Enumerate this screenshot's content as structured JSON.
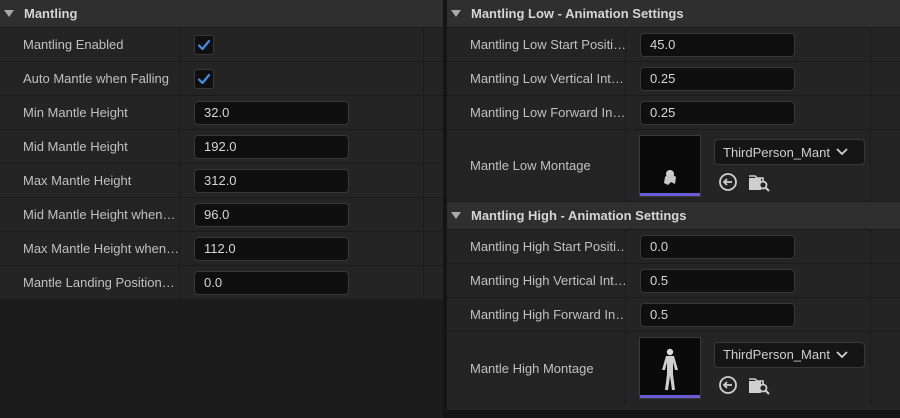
{
  "left": {
    "category": "Mantling",
    "rows": [
      {
        "label": "Mantling Enabled",
        "checked": true
      },
      {
        "label": "Auto Mantle when Falling",
        "checked": true
      },
      {
        "label": "Min Mantle Height",
        "value": "32.0"
      },
      {
        "label": "Mid Mantle Height",
        "value": "192.0"
      },
      {
        "label": "Max Mantle Height",
        "value": "312.0"
      },
      {
        "label": "Mid Mantle Height when…",
        "value": "96.0"
      },
      {
        "label": "Max Mantle Height when…",
        "value": "112.0"
      },
      {
        "label": "Mantle Landing Position…",
        "value": "0.0"
      }
    ]
  },
  "right": {
    "low": {
      "category": "Mantling Low - Animation Settings",
      "rows": [
        {
          "label": "Mantling Low Start Positi…",
          "value": "45.0"
        },
        {
          "label": "Mantling Low Vertical Int…",
          "value": "0.25"
        },
        {
          "label": "Mantling Low Forward In…",
          "value": "0.25"
        }
      ],
      "montage": {
        "label": "Mantle Low Montage",
        "asset": "ThirdPerson_Mant"
      }
    },
    "high": {
      "category": "Mantling High - Animation Settings",
      "rows": [
        {
          "label": "Mantling High Start Positi…",
          "value": "0.0"
        },
        {
          "label": "Mantling High Vertical Int…",
          "value": "0.5"
        },
        {
          "label": "Mantling High Forward In…",
          "value": "0.5"
        }
      ],
      "montage": {
        "label": "Mantle High Montage",
        "asset": "ThirdPerson_Mant"
      }
    }
  },
  "colors": {
    "checkmark": "#3a8fe8",
    "thumbnail_bar": "#6a5cd6"
  },
  "icons": [
    "collapse-arrow-icon",
    "checkmark-icon",
    "chevron-down-icon",
    "use-selected-asset-icon",
    "browse-asset-icon"
  ]
}
